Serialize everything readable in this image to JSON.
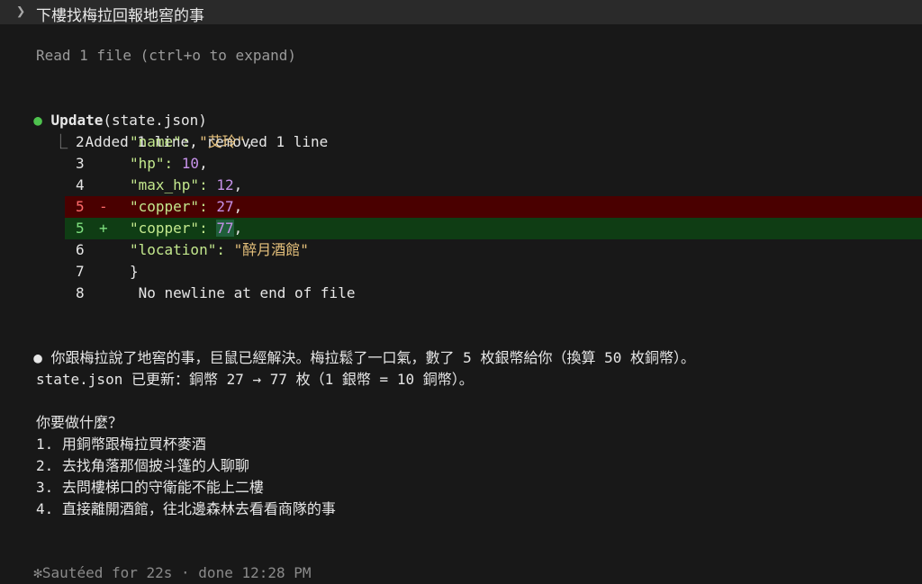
{
  "prompt": {
    "text": "下樓找梅拉回報地窖的事"
  },
  "read_note": "Read 1 file (ctrl+o to expand)",
  "update": {
    "title": "Update",
    "file": "(state.json)",
    "summary": "Added 1 line, removed 1 line",
    "lines": [
      {
        "n": "2",
        "mark": "",
        "pre": "\"name\": ",
        "val": "\"艾玲\"",
        "post": ","
      },
      {
        "n": "3",
        "mark": "",
        "pre": "\"hp\": ",
        "val": "10",
        "post": ","
      },
      {
        "n": "4",
        "mark": "",
        "pre": "\"max_hp\": ",
        "val": "12",
        "post": ","
      },
      {
        "n": "5",
        "mark": "-",
        "pre": "\"copper\": ",
        "val": "27",
        "post": ","
      },
      {
        "n": "5",
        "mark": "+",
        "pre": "\"copper\": ",
        "val": "77",
        "post": ","
      },
      {
        "n": "6",
        "mark": "",
        "pre": "\"location\": ",
        "val": "\"醉月酒館\"",
        "post": ""
      },
      {
        "n": "7",
        "mark": "",
        "pre": "}",
        "val": "",
        "post": ""
      },
      {
        "n": "8",
        "mark": "",
        "pre": " No newline at end of file",
        "val": "",
        "post": ""
      }
    ]
  },
  "reply": {
    "p1": "你跟梅拉說了地窖的事，巨鼠已經解決。梅拉鬆了一口氣，數了 5 枚銀幣給你（換算 50 枚銅幣）。",
    "p2": "state.json 已更新：銅幣 27 → 77 枚（1 銀幣 = 10 銅幣）。",
    "question": "你要做什麼？",
    "options": [
      "1. 用銅幣跟梅拉買杯麥酒",
      "2. 去找角落那個披斗篷的人聊聊",
      "3. 去問樓梯口的守衛能不能上二樓",
      "4. 直接離開酒館，往北邊森林去看看商隊的事"
    ]
  },
  "footer": {
    "icon": "✻",
    "text": "Sautéed for 22s · done 12:28 PM"
  }
}
